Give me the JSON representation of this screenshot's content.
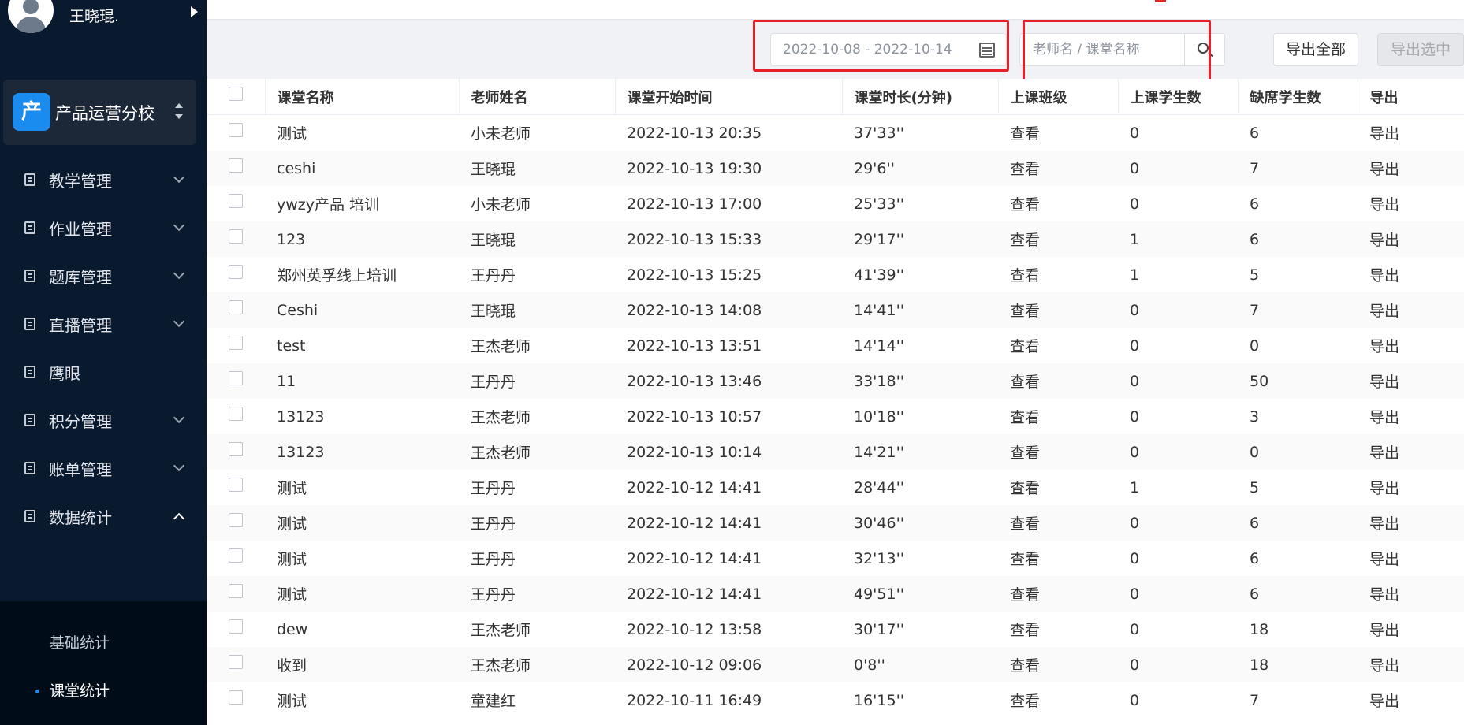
{
  "user": {
    "name": "王晓琨."
  },
  "school": {
    "logo_char": "产",
    "name": "产品运营分校"
  },
  "sidebar": {
    "items": [
      {
        "label": "教学管理",
        "expandable": true
      },
      {
        "label": "作业管理",
        "expandable": true
      },
      {
        "label": "题库管理",
        "expandable": true
      },
      {
        "label": "直播管理",
        "expandable": true
      },
      {
        "label": "鹰眼",
        "expandable": false
      },
      {
        "label": "积分管理",
        "expandable": true
      },
      {
        "label": "账单管理",
        "expandable": true
      },
      {
        "label": "数据统计",
        "expandable": true,
        "expanded": true
      }
    ],
    "sub_items": [
      {
        "label": "基础统计",
        "active": false
      },
      {
        "label": "课堂统计",
        "active": true
      }
    ]
  },
  "toolbar": {
    "date_range": "2022-10-08 - 2022-10-14",
    "search_placeholder": "老师名 / 课堂名称",
    "export_all": "导出全部",
    "export_selected": "导出选中"
  },
  "colors": {
    "accent": "#1a8cf0",
    "sidebar_bg": "#0a1a2e",
    "highlight": "#e8202a"
  },
  "table": {
    "columns": [
      "课堂名称",
      "老师姓名",
      "课堂开始时间",
      "课堂时长(分钟)",
      "上课班级",
      "上课学生数",
      "缺席学生数",
      "导出"
    ],
    "rows": [
      {
        "name": "测试",
        "teacher": "小未老师",
        "start": "2022-10-13 20:35",
        "duration": "37'33''",
        "class": "查看",
        "attended": "0",
        "absent": "6",
        "export": "导出"
      },
      {
        "name": "ceshi",
        "teacher": "王晓琨",
        "start": "2022-10-13 19:30",
        "duration": "29'6''",
        "class": "查看",
        "attended": "0",
        "absent": "7",
        "export": "导出"
      },
      {
        "name": "ywzy产品 培训",
        "teacher": "小未老师",
        "start": "2022-10-13 17:00",
        "duration": "25'33''",
        "class": "查看",
        "attended": "0",
        "absent": "6",
        "export": "导出"
      },
      {
        "name": "123",
        "teacher": "王晓琨",
        "start": "2022-10-13 15:33",
        "duration": "29'17''",
        "class": "查看",
        "attended": "1",
        "absent": "6",
        "export": "导出"
      },
      {
        "name": "郑州英孚线上培训",
        "teacher": "王丹丹",
        "start": "2022-10-13 15:25",
        "duration": "41'39''",
        "class": "查看",
        "attended": "1",
        "absent": "5",
        "export": "导出"
      },
      {
        "name": "Ceshi",
        "teacher": "王晓琨",
        "start": "2022-10-13 14:08",
        "duration": "14'41''",
        "class": "查看",
        "attended": "0",
        "absent": "7",
        "export": "导出"
      },
      {
        "name": "test",
        "teacher": "王杰老师",
        "start": "2022-10-13 13:51",
        "duration": "14'14''",
        "class": "查看",
        "attended": "0",
        "absent": "0",
        "export": "导出"
      },
      {
        "name": "11",
        "teacher": "王丹丹",
        "start": "2022-10-13 13:46",
        "duration": "33'18''",
        "class": "查看",
        "attended": "0",
        "absent": "50",
        "export": "导出"
      },
      {
        "name": "13123",
        "teacher": "王杰老师",
        "start": "2022-10-13 10:57",
        "duration": "10'18''",
        "class": "查看",
        "attended": "0",
        "absent": "3",
        "export": "导出"
      },
      {
        "name": "13123",
        "teacher": "王杰老师",
        "start": "2022-10-13 10:14",
        "duration": "14'21''",
        "class": "查看",
        "attended": "0",
        "absent": "0",
        "export": "导出"
      },
      {
        "name": "测试",
        "teacher": "王丹丹",
        "start": "2022-10-12 14:41",
        "duration": "28'44''",
        "class": "查看",
        "attended": "1",
        "absent": "5",
        "export": "导出"
      },
      {
        "name": "测试",
        "teacher": "王丹丹",
        "start": "2022-10-12 14:41",
        "duration": "30'46''",
        "class": "查看",
        "attended": "0",
        "absent": "6",
        "export": "导出"
      },
      {
        "name": "测试",
        "teacher": "王丹丹",
        "start": "2022-10-12 14:41",
        "duration": "32'13''",
        "class": "查看",
        "attended": "0",
        "absent": "6",
        "export": "导出"
      },
      {
        "name": "测试",
        "teacher": "王丹丹",
        "start": "2022-10-12 14:41",
        "duration": "49'51''",
        "class": "查看",
        "attended": "0",
        "absent": "6",
        "export": "导出"
      },
      {
        "name": "dew",
        "teacher": "王杰老师",
        "start": "2022-10-12 13:58",
        "duration": "30'17''",
        "class": "查看",
        "attended": "0",
        "absent": "18",
        "export": "导出"
      },
      {
        "name": "收到",
        "teacher": "王杰老师",
        "start": "2022-10-12 09:06",
        "duration": "0'8''",
        "class": "查看",
        "attended": "0",
        "absent": "18",
        "export": "导出"
      },
      {
        "name": "测试",
        "teacher": "童建红",
        "start": "2022-10-11 16:49",
        "duration": "16'15''",
        "class": "查看",
        "attended": "0",
        "absent": "7",
        "export": "导出"
      }
    ]
  }
}
